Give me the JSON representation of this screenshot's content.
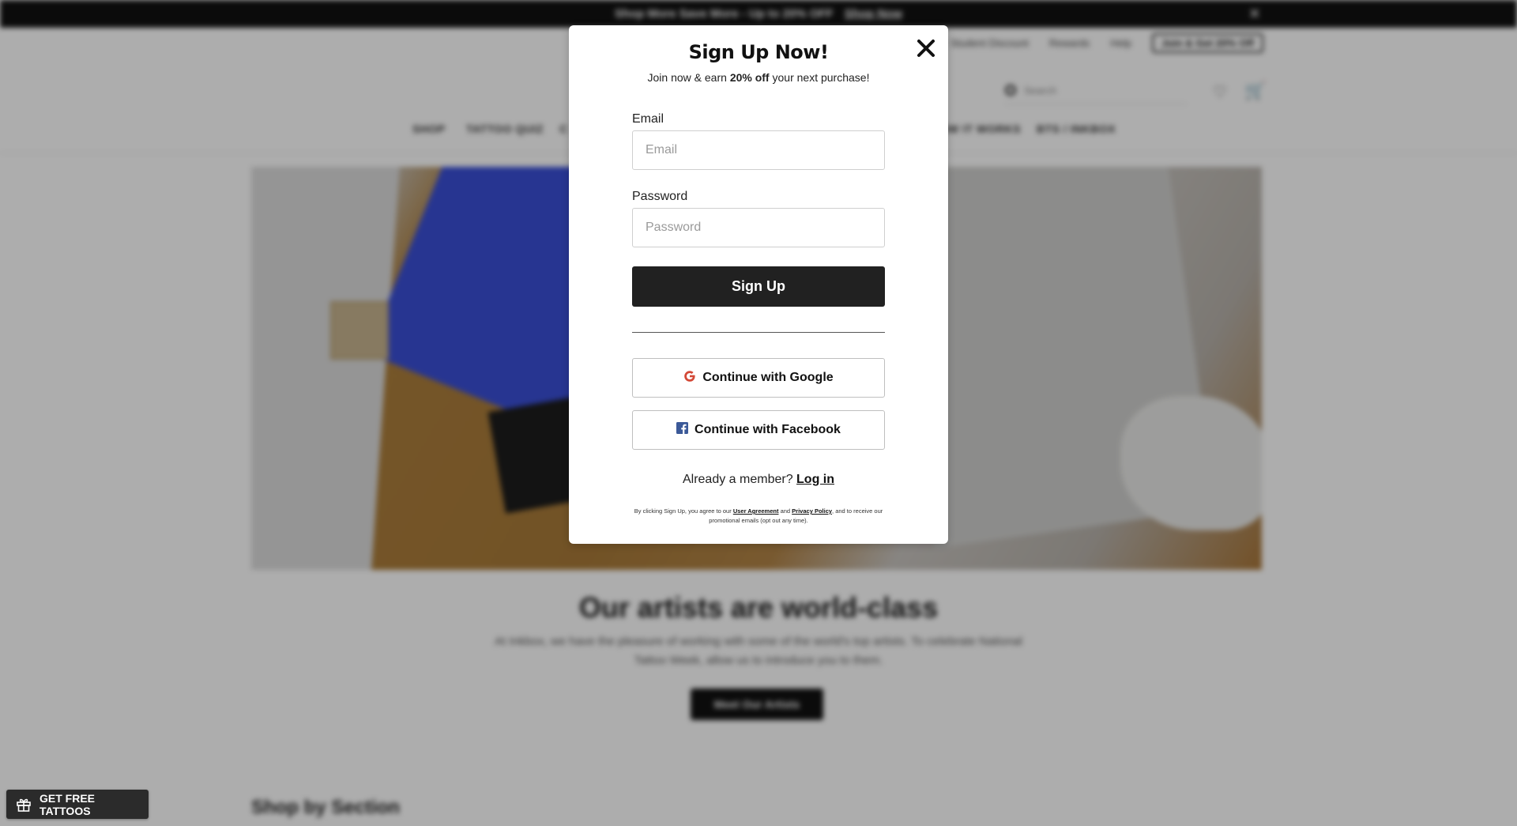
{
  "announcement": {
    "text": "Shop More Save More - Up to 20% OFF",
    "link": "Shop Now",
    "close": "✕"
  },
  "utility": {
    "student": "Student Discount",
    "rewards": "Rewards",
    "help": "Help",
    "join": "Join & Get 20% Off"
  },
  "header": {
    "search_placeholder": "Search"
  },
  "nav": [
    "SHOP",
    "TATTOO QUIZ",
    "C",
    "HOW IT WORKS",
    "BTS / INKBOX"
  ],
  "content": {
    "title": "Our artists are world-class",
    "description": "At Inkbox, we have the pleasure of working with some of the world's top artists. To celebrate National Tattoo Week, allow us to introduce you to them.",
    "button": "Meet Our Artists",
    "section_title": "Shop by Section"
  },
  "free_tab": {
    "label": "GET FREE TATTOOS"
  },
  "modal": {
    "title": "Sign Up Now!",
    "subtitle_pre": "Join now & earn ",
    "subtitle_bold": "20% off",
    "subtitle_post": " your next purchase!",
    "email_label": "Email",
    "email_placeholder": "Email",
    "email_value": "",
    "password_label": "Password",
    "password_placeholder": "Password",
    "password_value": "",
    "signup_button": "Sign Up",
    "google_button": "Continue with Google",
    "facebook_button": "Continue with Facebook",
    "member_text": "Already a member? ",
    "login_link": "Log in",
    "legal_pre": "By clicking Sign Up, you agree to our ",
    "legal_agreement": "User Agreement",
    "legal_and": " and ",
    "legal_privacy": "Privacy Policy",
    "legal_post": ", and to receive our promotional emails (opt out any time).",
    "close_icon": "close-icon"
  },
  "colors": {
    "primary_button": "#212121",
    "google_red": "#d34836",
    "facebook_blue": "#3b5998"
  }
}
